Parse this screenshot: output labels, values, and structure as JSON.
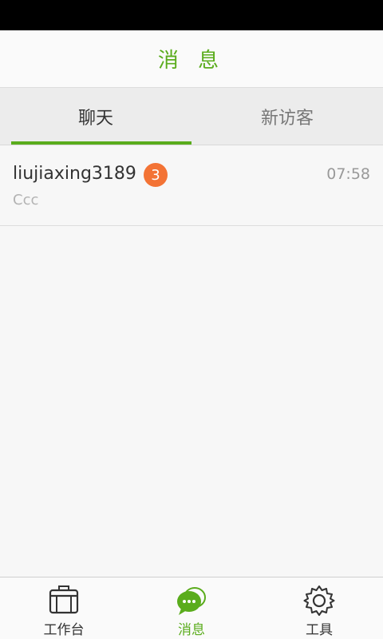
{
  "header": {
    "title": "消 息"
  },
  "tabs": [
    {
      "label": "聊天",
      "active": true
    },
    {
      "label": "新访客",
      "active": false
    }
  ],
  "chats": [
    {
      "name": "liujiaxing3189",
      "unread": "3",
      "time": "07:58",
      "preview": "Ccc"
    }
  ],
  "bottom_nav": [
    {
      "label": "工作台",
      "icon": "briefcase-icon",
      "active": false
    },
    {
      "label": "消息",
      "icon": "chat-bubble-icon",
      "active": true
    },
    {
      "label": "工具",
      "icon": "gear-icon",
      "active": false
    }
  ],
  "colors": {
    "accent": "#5aac1c",
    "badge": "#f37335",
    "background": "#f7f7f7"
  }
}
